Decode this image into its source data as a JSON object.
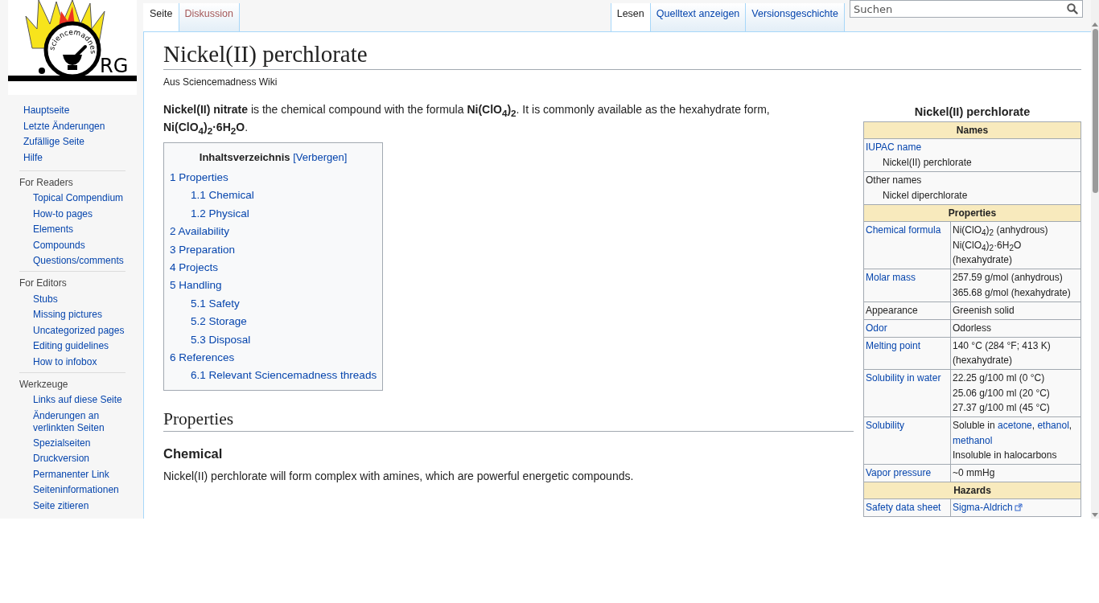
{
  "logo": {
    "ring_text": "sciencemadness",
    "suffix": "RG"
  },
  "sidebar": {
    "main_items": [
      "Hauptseite",
      "Letzte Änderungen",
      "Zufällige Seite",
      "Hilfe"
    ],
    "portals": [
      {
        "heading": "For Readers",
        "items": [
          "Topical Compendium",
          "How-to pages",
          "Elements",
          "Compounds",
          "Questions/comments"
        ]
      },
      {
        "heading": "For Editors",
        "items": [
          "Stubs",
          "Missing pictures",
          "Uncategorized pages",
          "Editing guidelines",
          "How to infobox"
        ]
      },
      {
        "heading": "Werkzeuge",
        "items": [
          "Links auf diese Seite",
          "Änderungen an verlinkten Seiten",
          "Spezialseiten",
          "Druckversion",
          "Permanenter Link",
          "Seiteninformationen",
          "Seite zitieren"
        ]
      }
    ]
  },
  "tabs_left": [
    {
      "label": "Seite",
      "selected": true,
      "new": false
    },
    {
      "label": "Diskussion",
      "selected": false,
      "new": true
    }
  ],
  "tabs_right": [
    {
      "label": "Lesen",
      "selected": true
    },
    {
      "label": "Quelltext anzeigen",
      "selected": false
    },
    {
      "label": "Versionsgeschichte",
      "selected": false
    }
  ],
  "search": {
    "placeholder": "Suchen"
  },
  "title": "Nickel(II) perchlorate",
  "subtitle": "Aus Sciencemadness Wiki",
  "intro": "**Nickel(II) nitrate** is the chemical compound with the formula **Ni(ClO$_{4}$)$_{2}$**. It is commonly available as the hexahydrate form, **Ni(ClO$_{4}$)$_{2}$·6H$_{2}$O**.",
  "toc": {
    "title": "Inhaltsverzeichnis",
    "toggle": "[Verbergen]",
    "items": [
      {
        "number": "1",
        "text": "Properties",
        "children": [
          {
            "number": "1.1",
            "text": "Chemical"
          },
          {
            "number": "1.2",
            "text": "Physical"
          }
        ]
      },
      {
        "number": "2",
        "text": "Availability"
      },
      {
        "number": "3",
        "text": "Preparation"
      },
      {
        "number": "4",
        "text": "Projects"
      },
      {
        "number": "5",
        "text": "Handling",
        "children": [
          {
            "number": "5.1",
            "text": "Safety"
          },
          {
            "number": "5.2",
            "text": "Storage"
          },
          {
            "number": "5.3",
            "text": "Disposal"
          }
        ]
      },
      {
        "number": "6",
        "text": "References",
        "children": [
          {
            "number": "6.1",
            "text": "Relevant Sciencemadness threads"
          }
        ]
      }
    ]
  },
  "section": {
    "heading": "Properties",
    "subheading": "Chemical",
    "text": "Nickel(II) perchlorate will form complex with amines, which are powerful energetic compounds."
  },
  "infobox": {
    "title": "Nickel(II) perchlorate",
    "rows": [
      {
        "kind": "header",
        "text": "Names"
      },
      {
        "kind": "wide",
        "label": "IUPAC name",
        "label_link": true,
        "value": "Nickel(II) perchlorate"
      },
      {
        "kind": "wide",
        "label": "Other names",
        "label_link": false,
        "value": "Nickel diperchlorate"
      },
      {
        "kind": "header",
        "text": "Properties"
      },
      {
        "kind": "pair",
        "label": "Chemical formula",
        "label_link": true,
        "lines": [
          [
            {
              "text": "Ni(ClO$_{4}$)$_{2}$ (anhydrous)",
              "link": false
            }
          ],
          [
            {
              "text": "Ni(ClO$_{4}$)$_{2}$·6H$_{2}$O (hexahydrate)",
              "link": false
            }
          ]
        ]
      },
      {
        "kind": "pair",
        "label": "Molar mass",
        "label_link": true,
        "lines": [
          [
            {
              "text": "257.59 g/mol (anhydrous)",
              "link": false
            }
          ],
          [
            {
              "text": "365.68 g/mol (hexahydrate)",
              "link": false
            }
          ]
        ]
      },
      {
        "kind": "pair",
        "label": "Appearance",
        "label_link": false,
        "lines": [
          [
            {
              "text": "Greenish solid",
              "link": false
            }
          ]
        ]
      },
      {
        "kind": "pair",
        "label": "Odor",
        "label_link": true,
        "lines": [
          [
            {
              "text": "Odorless",
              "link": false
            }
          ]
        ]
      },
      {
        "kind": "pair",
        "label": "Melting point",
        "label_link": true,
        "lines": [
          [
            {
              "text": "140 °C (284 °F; 413 K) (hexahydrate)",
              "link": false
            }
          ]
        ]
      },
      {
        "kind": "pair",
        "label": "Solubility in water",
        "label_link": true,
        "lines": [
          [
            {
              "text": "22.25 g/100 ml (0 °C)",
              "link": false
            }
          ],
          [
            {
              "text": "25.06 g/100 ml (20 °C)",
              "link": false
            }
          ],
          [
            {
              "text": "27.37 g/100 ml (45 °C)",
              "link": false
            }
          ]
        ]
      },
      {
        "kind": "pair",
        "label": "Solubility",
        "label_link": true,
        "lines": [
          [
            {
              "text": "Soluble in ",
              "link": false
            },
            {
              "text": "acetone",
              "link": true
            },
            {
              "text": ", ",
              "link": false
            },
            {
              "text": "ethanol",
              "link": true
            },
            {
              "text": ", ",
              "link": false
            },
            {
              "text": "methanol",
              "link": true
            }
          ],
          [
            {
              "text": "Insoluble in halocarbons",
              "link": false
            }
          ]
        ]
      },
      {
        "kind": "pair",
        "label": "Vapor pressure",
        "label_link": true,
        "lines": [
          [
            {
              "text": "~0 mmHg",
              "link": false
            }
          ]
        ]
      },
      {
        "kind": "header",
        "text": "Hazards"
      },
      {
        "kind": "pair",
        "label": "Safety data sheet",
        "label_link": true,
        "lines": [
          [
            {
              "text": "Sigma-Aldrich",
              "link": true,
              "external": true
            }
          ]
        ]
      }
    ]
  }
}
